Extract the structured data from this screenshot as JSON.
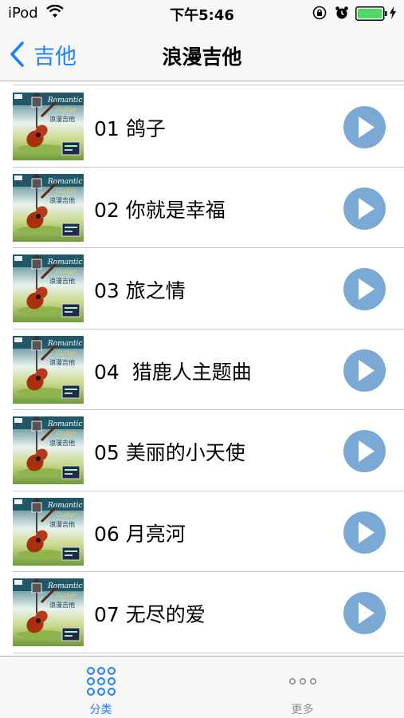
{
  "status_bar": {
    "carrier": "iPod",
    "time": "下午5:46",
    "icons": [
      "wifi-icon",
      "orientation-lock-icon",
      "alarm-icon",
      "battery-icon",
      "charging-icon"
    ]
  },
  "nav": {
    "back_label": "吉他",
    "title": "浪漫吉他"
  },
  "songs": [
    {
      "label": "01 鸽子"
    },
    {
      "label": "02 你就是幸福"
    },
    {
      "label": "03 旅之情"
    },
    {
      "label": "04  猎鹿人主题曲"
    },
    {
      "label": "05 美丽的小天使"
    },
    {
      "label": "06 月亮河"
    },
    {
      "label": "07 无尽的爱"
    }
  ],
  "tabs": [
    {
      "label": "分类",
      "icon": "grid-icon",
      "selected": true
    },
    {
      "label": "更多",
      "icon": "more-icon",
      "selected": false
    }
  ],
  "colors": {
    "accent": "#1a82fb",
    "play_button": "#7aa9d6",
    "battery": "#4cd964",
    "separator": "#c8c7cc"
  }
}
